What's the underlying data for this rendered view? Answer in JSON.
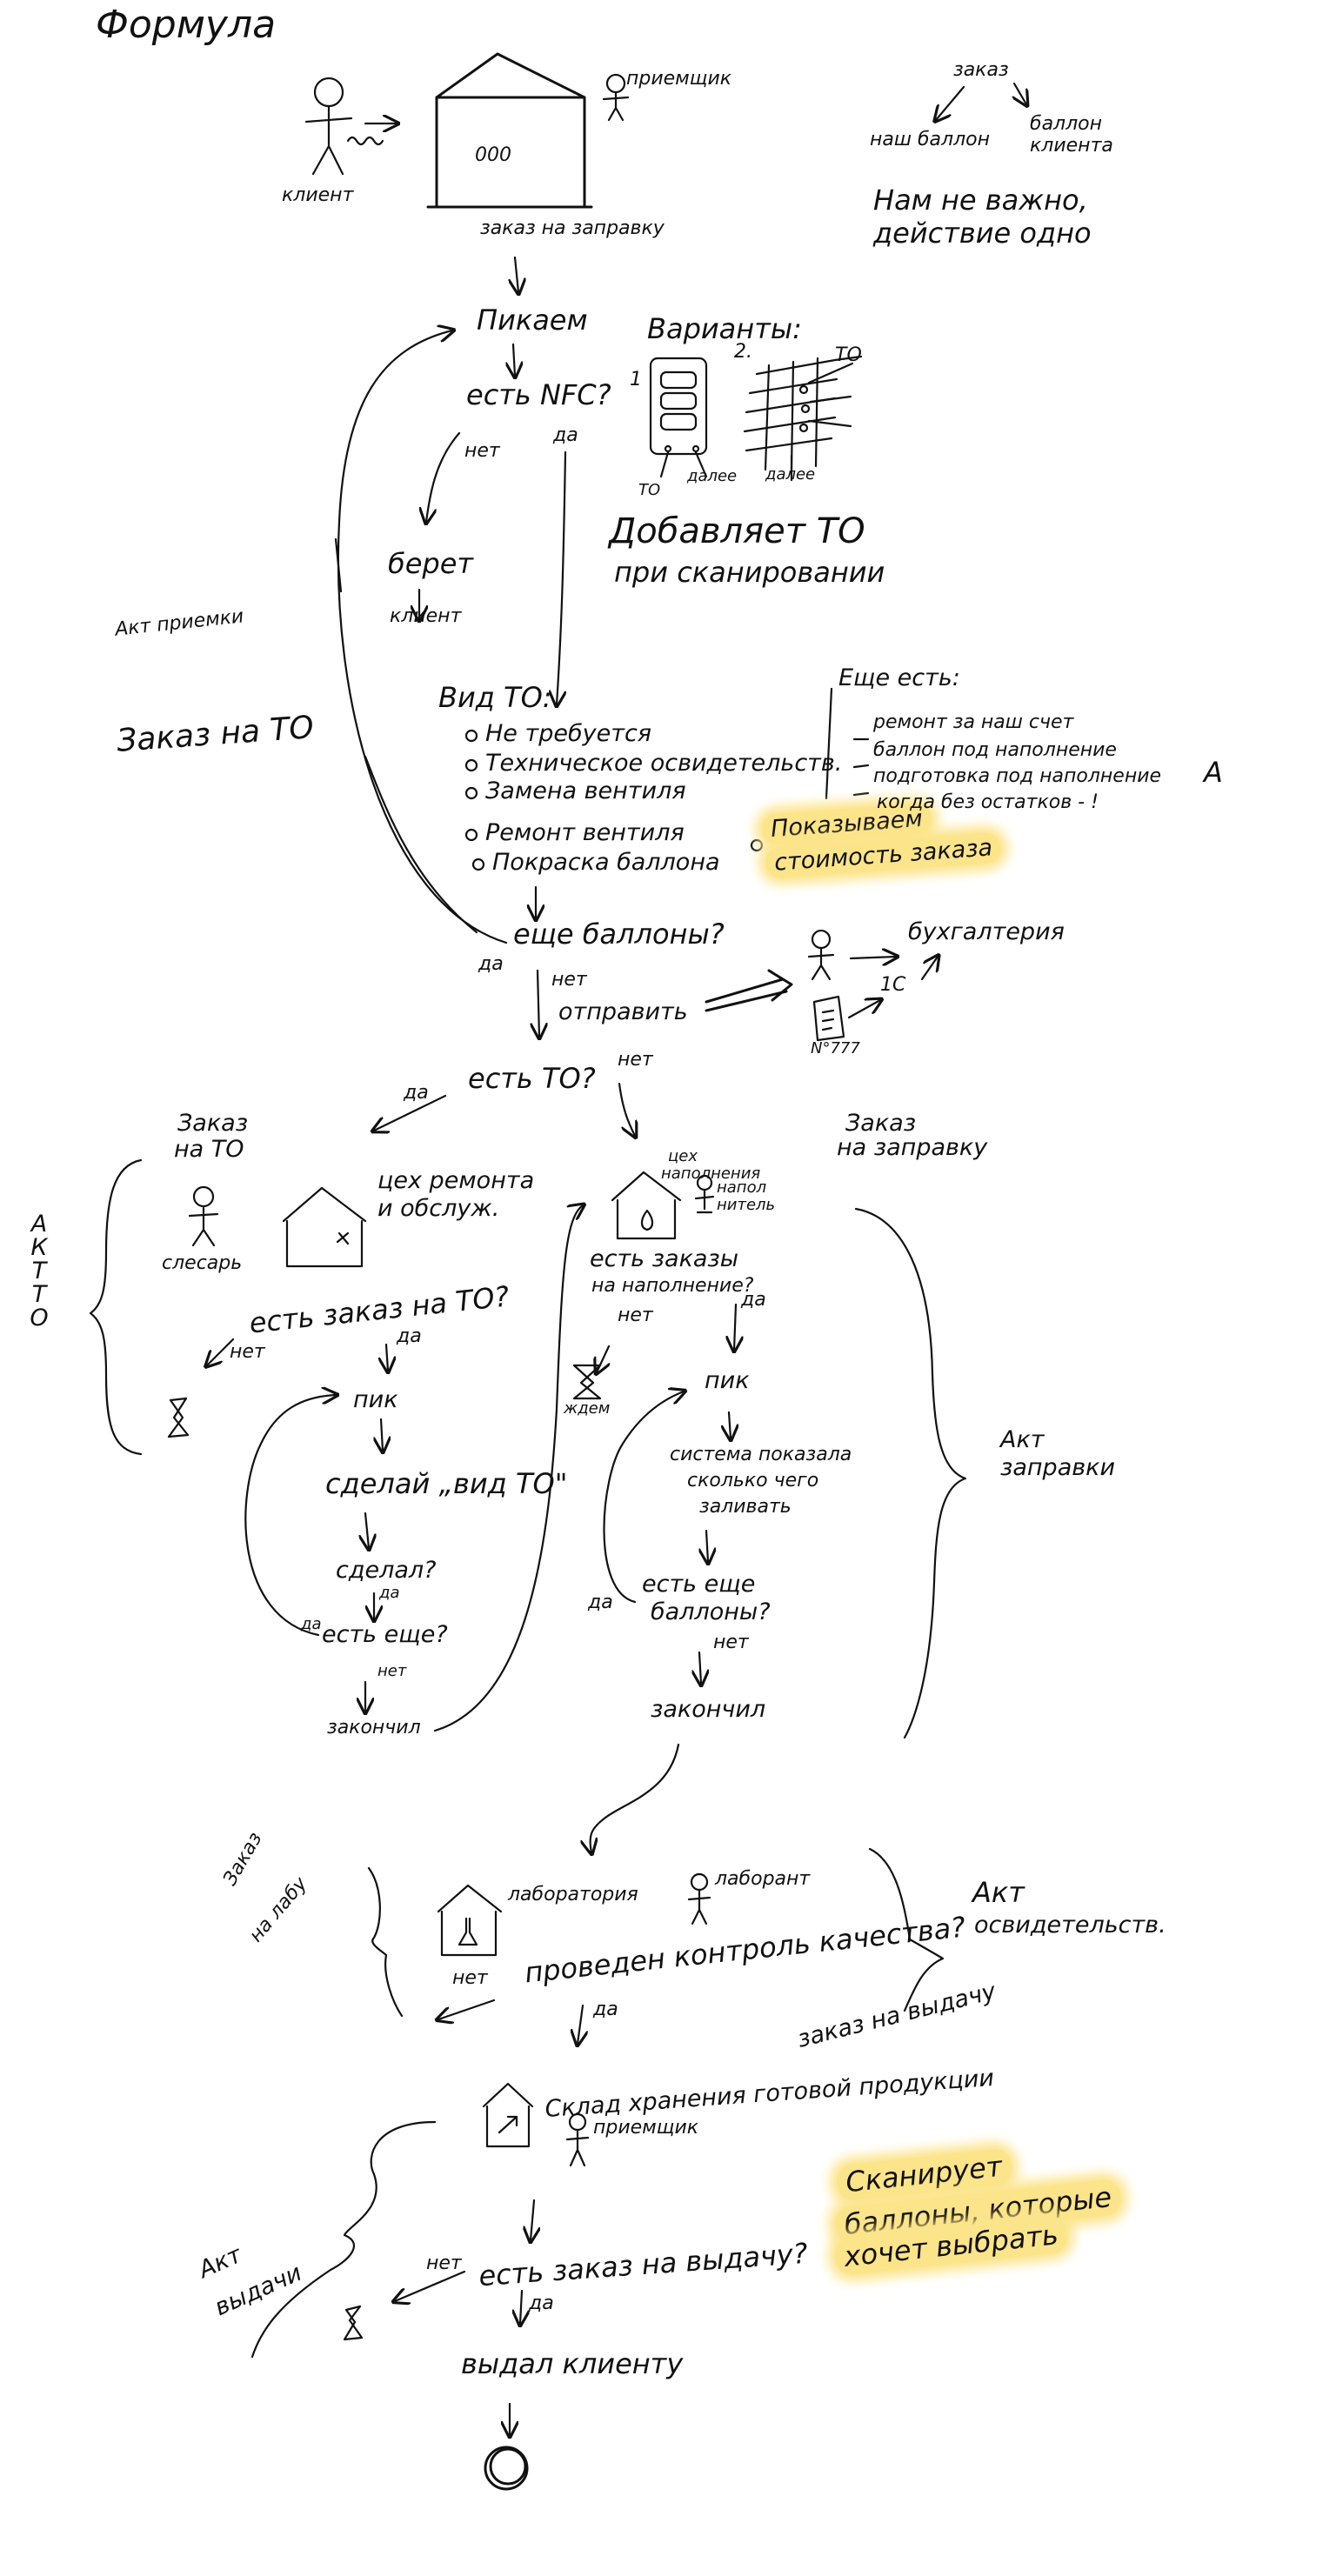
{
  "title": "Формула",
  "top": {
    "client": "клиент",
    "receiver": "приемщик",
    "order_refill": "заказ на заправку",
    "order": "заказ",
    "our_cylinder": "наш баллон",
    "client_cylinder": "баллон клиента",
    "not_important_1": "Нам не важно,",
    "not_important_2": "действие одно"
  },
  "scan": {
    "pick": "Пикаем",
    "has_nfc": "есть NFC?",
    "no": "нет",
    "yes": "да",
    "takes": "берет",
    "client": "клиент",
    "variants": "Варианты:",
    "v1": "1",
    "v2": "2.",
    "to_label": "ТО",
    "next1": "далее",
    "next2": "далее",
    "adds_to_1": "Добавляет ТО",
    "adds_to_2": "при сканировании"
  },
  "side": {
    "acceptance_act": "Акт приемки",
    "order_to": "Заказ на ТО"
  },
  "to_types": {
    "header": "Вид ТО:",
    "items": [
      "Не требуется",
      "Техническое освидетельств.",
      "Замена вентиля",
      "Ремонт вентиля",
      "Покраска баллона"
    ],
    "show_cost_1": "Показываем",
    "show_cost_2": "стоимость заказа",
    "more_header": "Еще есть:",
    "more_items": [
      "ремонт за наш счет",
      "баллон под наполнение",
      "подготовка под наполнение",
      "когда без остатков - !"
    ],
    "mark": "A"
  },
  "more_cylinders": {
    "q": "еще баллоны?",
    "yes": "да",
    "no": "нет",
    "send": "отправить",
    "accounting": "бухгалтерия",
    "onec": "1С",
    "num": "N°777"
  },
  "has_to": {
    "q": "есть ТО?",
    "yes": "да",
    "no": "нет"
  },
  "repair": {
    "order_label_1": "Заказ",
    "order_label_2": "на ТО",
    "act_vertical": "АКТ ТО",
    "mechanic": "слесарь",
    "shop_1": "цех ремонта",
    "shop_2": "и обслуж.",
    "q": "есть заказ на ТО?",
    "no": "нет",
    "yes": "да",
    "pick": "пик",
    "do_to": "сделай „вид ТО\"",
    "done_q": "сделал?",
    "yes2": "да",
    "more_q": "есть еще?",
    "yes3": "да",
    "no2": "нет",
    "finished": "закончил"
  },
  "fill": {
    "shop_1": "цех",
    "shop_2": "наполнения",
    "filler_1": "напол",
    "filler_2": "нитель",
    "order_label_1": "Заказ",
    "order_label_2": "на заправку",
    "q_1": "есть заказы",
    "q_2": "на наполнение?",
    "no": "нет",
    "yes": "да",
    "wait": "ждем",
    "pick": "пик",
    "shows_1": "система показала",
    "shows_2": "сколько чего",
    "shows_3": "заливать",
    "more_1": "есть еще",
    "more_2": "баллоны?",
    "yes2": "да",
    "no2": "нет",
    "finished": "закончил",
    "act_1": "Акт",
    "act_2": "заправки"
  },
  "lab": {
    "order_1": "Заказ",
    "order_2": "на лабу",
    "lab": "лаборатория",
    "assistant": "лаборант",
    "qc": "проведен контроль качества?",
    "no": "нет",
    "yes": "да",
    "act_1": "Акт",
    "act_2": "освидетельств."
  },
  "storage": {
    "order_issue": "заказ на выдачу",
    "warehouse": "Склад хранения готовой продукции",
    "receiver": "приемщик",
    "scan_1": "Сканирует",
    "scan_2": "баллоны, которые",
    "scan_3": "хочет выбрать",
    "act_1": "Акт",
    "act_2": "выдачи",
    "q": "есть заказ на выдачу?",
    "no": "нет",
    "yes": "да",
    "gave": "выдал клиенту"
  }
}
